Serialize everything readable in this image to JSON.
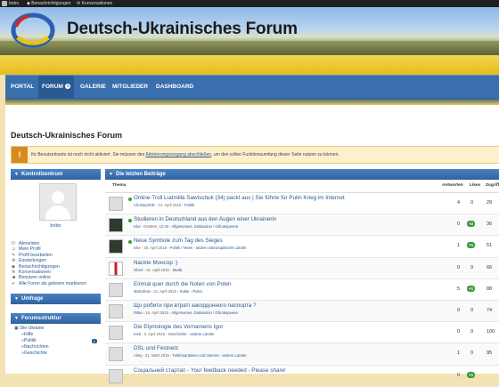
{
  "topbar": {
    "user": "bobo",
    "notifications": "Benachrichtigungen",
    "conversations": "Konversationen"
  },
  "site": {
    "title": "Deutsch-Ukrainisches Forum"
  },
  "nav": {
    "tabs": [
      {
        "label": "PORTAL"
      },
      {
        "label": "FORUM",
        "count": "1"
      },
      {
        "label": "GALERIE"
      },
      {
        "label": "MITGLIEDER"
      },
      {
        "label": "DASHBOARD"
      }
    ]
  },
  "page_title": "Deutsch-Ukrainisches Forum",
  "warning": {
    "text_before": "Ihr Benutzerkonto ist noch nicht aktiviert. Sie müssen den",
    "link": "Aktivierungsvorgang abschließen",
    "text_after": ", um den vollen Funktionsumfang dieser Seite nutzen zu können."
  },
  "sidebar": {
    "control_title": "Kontrollzentrum",
    "username": "bobo",
    "links": [
      "Abmelden",
      "Mein Profil",
      "Profil bearbeiten",
      "Einstellungen",
      "Benachrichtigungen",
      "Konversationen",
      "Benutzer online",
      "Alle Foren als gelesen markieren"
    ],
    "poll_title": "Umfrage",
    "tree_title": "Forumsstruktur",
    "tree": [
      {
        "label": "Die Ukraine"
      },
      {
        "label": "»Hilfe"
      },
      {
        "label": "»Politik",
        "badge": "1"
      },
      {
        "label": "»Nachrichten"
      },
      {
        "label": "»Geschichte"
      }
    ]
  },
  "main": {
    "title": "Die letzten Beiträge",
    "columns": {
      "theme": "Thema",
      "answers": "Antworten",
      "likes": "Likes",
      "hits": "Zugriffe"
    },
    "rows": [
      {
        "title": "Online-Troll Ludmilla Sawtschuk (34) packt aus | Sie führte für Putin Krieg im Internet",
        "author": "ChristophHE",
        "date": "12. April 2015",
        "board": "Politik",
        "answers": "4",
        "likes": "",
        "hits": "29",
        "thumb": "avatar",
        "unread": "yes"
      },
      {
        "title": "Studieren in Deutschland aus den Augen einer Ukrainerin",
        "author": "Icke",
        "date": "Gestern, 15:40",
        "board": "Allgemeines, Diskussion / Обговорення",
        "answers": "0",
        "likes": "+2",
        "hits": "36",
        "thumb": "dark",
        "unread": "yes"
      },
      {
        "title": "Neue Symbole zum Tag des Sieges",
        "author": "Icke",
        "date": "25. April 2015",
        "board": "Politik / News - andere osteuropäische Länder",
        "answers": "1",
        "likes": "+1",
        "hits": "51",
        "thumb": "dark",
        "unread": "yes"
      },
      {
        "title": "Nackte Монсор :)",
        "author": "inbert",
        "date": "21. April 2015",
        "board": "Musik",
        "answers": "0",
        "likes": "",
        "hits": "66",
        "thumb": "flag",
        "unread": "no"
      },
      {
        "title": "Einmal quer durch die Noten von Polen",
        "author": "Malcolmis",
        "date": "21. April 2015",
        "board": "Kultur - Polen",
        "answers": "5",
        "likes": "+1",
        "hits": "88",
        "thumb": "avatar",
        "unread": "no"
      },
      {
        "title": "Що робити при втраті закордонного паспорта ?",
        "author": "Ritka",
        "date": "15. April 2015",
        "board": "Allgemeines, Diskussion / Обговорення",
        "answers": "0",
        "likes": "",
        "hits": "74",
        "thumb": "avatar",
        "unread": "no"
      },
      {
        "title": "Die Etymologie des Vornamens Igor",
        "author": "Inek",
        "date": "3. April 2015",
        "board": "Geschichte - andere Länder",
        "answers": "0",
        "likes": "",
        "hits": "100",
        "thumb": "avatar",
        "unread": "no"
      },
      {
        "title": "DSL und Festnetz",
        "author": "Almy",
        "date": "31. März 2015",
        "board": "Telefonanbieter und Internet - andere Länder",
        "answers": "1",
        "likes": "",
        "hits": "95",
        "thumb": "avatar",
        "unread": "no"
      },
      {
        "title": "Соціальний стартап - Your feedback needed - Please share!",
        "author": "",
        "date": "",
        "board": "",
        "answers": "0",
        "likes": "+1",
        "hits": "",
        "thumb": "avatar",
        "unread": "no"
      }
    ]
  }
}
